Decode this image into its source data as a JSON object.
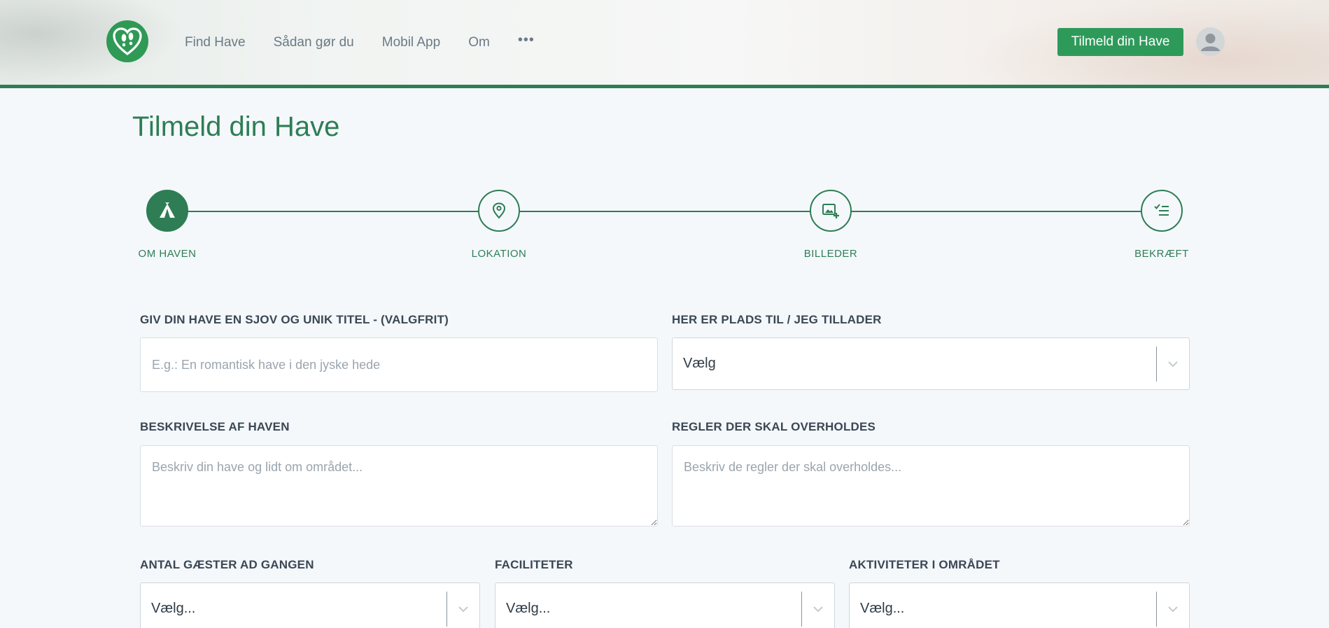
{
  "header": {
    "nav": [
      {
        "label": "Find Have"
      },
      {
        "label": "Sådan gør du"
      },
      {
        "label": "Mobil App"
      },
      {
        "label": "Om"
      }
    ],
    "more_label": "•••",
    "cta_label": "Tilmeld din Have",
    "logo_icon": "heart-footprints-logo-icon",
    "avatar_icon": "user-avatar-icon"
  },
  "page": {
    "title": "Tilmeld din Have"
  },
  "stepper": {
    "steps": [
      {
        "label": "OM HAVEN",
        "icon": "tent-icon",
        "active": true
      },
      {
        "label": "LOKATION",
        "icon": "map-pin-icon",
        "active": false
      },
      {
        "label": "BILLEDER",
        "icon": "add-image-icon",
        "active": false
      },
      {
        "label": "BEKRÆFT",
        "icon": "checklist-icon",
        "active": false
      }
    ]
  },
  "form": {
    "title_field": {
      "label": "GIV DIN HAVE EN SJOV OG UNIK TITEL - (VALGFRIT)",
      "placeholder": "E.g.: En romantisk have i den jyske hede"
    },
    "allow_field": {
      "label": "HER ER PLADS TIL / JEG TILLADER",
      "value": "Vælg"
    },
    "description_field": {
      "label": "BESKRIVELSE AF HAVEN",
      "placeholder": "Beskriv din have og lidt om området..."
    },
    "rules_field": {
      "label": "REGLER DER SKAL OVERHOLDES",
      "placeholder": "Beskriv de regler der skal overholdes..."
    },
    "guests_field": {
      "label": "ANTAL GÆSTER AD GANGEN",
      "value": "Vælg..."
    },
    "facilities_field": {
      "label": "FACILITETER",
      "value": "Vælg..."
    },
    "activities_field": {
      "label": "AKTIVITETER I OMRÅDET",
      "value": "Vælg..."
    }
  },
  "colors": {
    "brand_green": "#2f7d55",
    "cta_green": "#2e9a5a",
    "background": "#f4f8fb"
  }
}
